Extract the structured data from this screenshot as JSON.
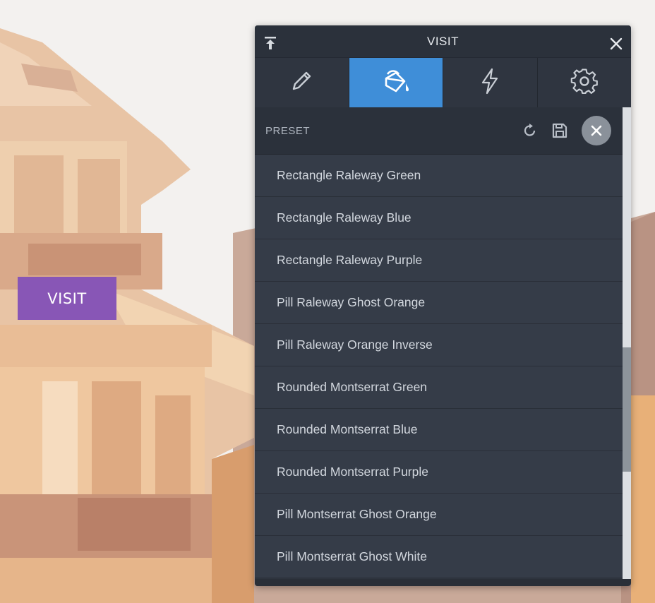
{
  "page": {
    "visit_button_label": "VISIT",
    "button_color": "#8856b6"
  },
  "panel": {
    "title": "VISIT",
    "pin_icon": "pin-top-icon",
    "close_icon": "close-icon",
    "tabs": [
      {
        "icon": "pencil-icon",
        "active": false
      },
      {
        "icon": "paint-bucket-icon",
        "active": true
      },
      {
        "icon": "lightning-icon",
        "active": false
      },
      {
        "icon": "gear-icon",
        "active": false
      }
    ],
    "accent_color": "#3f8ed8",
    "preset": {
      "label": "PRESET",
      "reset_icon": "reset-icon",
      "save_icon": "save-icon",
      "close_icon": "close-circle-icon"
    },
    "items": [
      "Rectangle Raleway Green",
      "Rectangle Raleway Blue",
      "Rectangle Raleway Purple",
      "Pill Raleway Ghost Orange",
      "Pill Raleway Orange Inverse",
      "Rounded Montserrat Green",
      "Rounded Montserrat Blue",
      "Rounded Montserrat Purple",
      "Pill Montserrat Ghost Orange",
      "Pill Montserrat Ghost White"
    ],
    "scroll_position": 0.65
  }
}
